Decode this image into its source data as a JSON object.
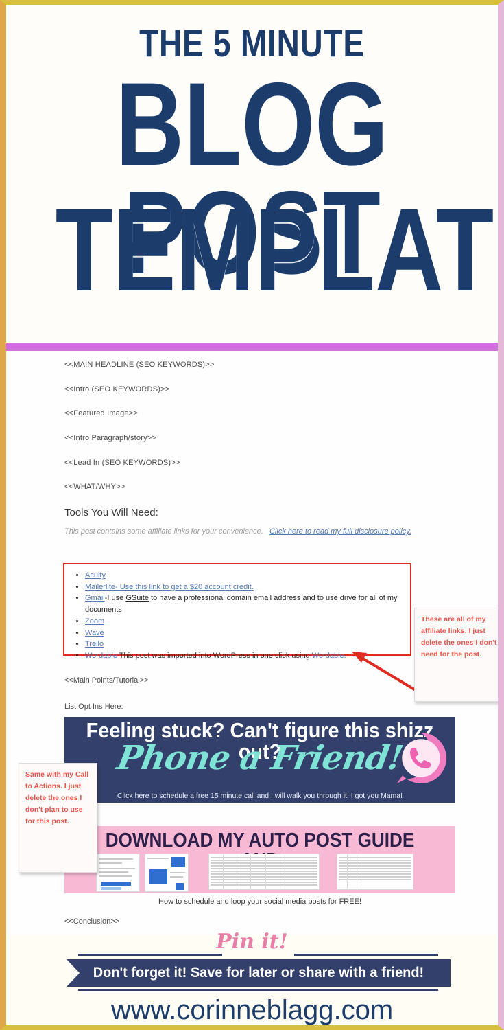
{
  "pin": {
    "border_gold": "#d9bf3e",
    "border_orange": "#e0a64a",
    "border_pink": "#e6b8d8",
    "navy": "#1c3d6b",
    "magenta": "#d06ede",
    "red": "#e02b20",
    "callout_red": "#e8554b",
    "teal": "#7fe3d6",
    "banner_pink": "#f8b9d4"
  },
  "hero": {
    "kicker": "THE 5 MINUTE",
    "line1": "BLOG POST",
    "line2": "TEMPLATE"
  },
  "doc": {
    "placeholders": [
      "<<MAIN HEADLINE (SEO KEYWORDS)>>",
      "<<Intro (SEO KEYWORDS)>>",
      "<<Featured Image>>",
      "<<Intro Paragraph/story>>",
      "<<Lead In (SEO KEYWORDS)>>",
      "<<WHAT/WHY>>"
    ],
    "tools_heading": "Tools You Will Need:",
    "disclosure_text": "This post contains some affiliate links for your convenience.",
    "disclosure_link": "Click here to read my full disclosure policy.",
    "links": [
      {
        "link": "Acuity",
        "rest": ""
      },
      {
        "link": "Mailerlite- Use this link to get a $20 account credit.",
        "rest": ""
      },
      {
        "link": "Gmail",
        "rest": "-I use GSuite to have a professional domain email address and to use drive for all of my documents"
      },
      {
        "link": "Zoom",
        "rest": ""
      },
      {
        "link": "Wave",
        "rest": ""
      },
      {
        "link": "Trello",
        "rest": ""
      },
      {
        "link": "Wordable",
        "rest": " This post was imported into WordPress in one click using Wordable."
      }
    ],
    "main_points": "<<Main Points/Tutorial>>",
    "opt_ins": "List Opt Ins Here:",
    "conclusion": "<<Conclusion>>"
  },
  "callouts": {
    "right": "These are all of my affiliate links.  I just delete the ones I don't need for the post.",
    "left": "Same with my Call to Actions.  I just delete the ones I don't plan to use for this post."
  },
  "banner_phone": {
    "headline": "Feeling stuck? Can't figure this shizz out?",
    "script": "Phone a Friend!",
    "subtext": "Click here to schedule a free 15 minute call and I will walk you through it!  I got you Mama!",
    "icon": "whatsapp-phone-icon"
  },
  "banner_pink": {
    "title": "DOWNLOAD MY AUTO POST GUIDE AND",
    "subtext": "How to schedule and loop your social media posts for FREE!"
  },
  "pinit": {
    "script": "Pin it!",
    "ribbon": "Don't forget it! Save for later or share with a friend!"
  },
  "footer": {
    "url": "www.corinneblagg.com",
    "watermark": ""
  }
}
